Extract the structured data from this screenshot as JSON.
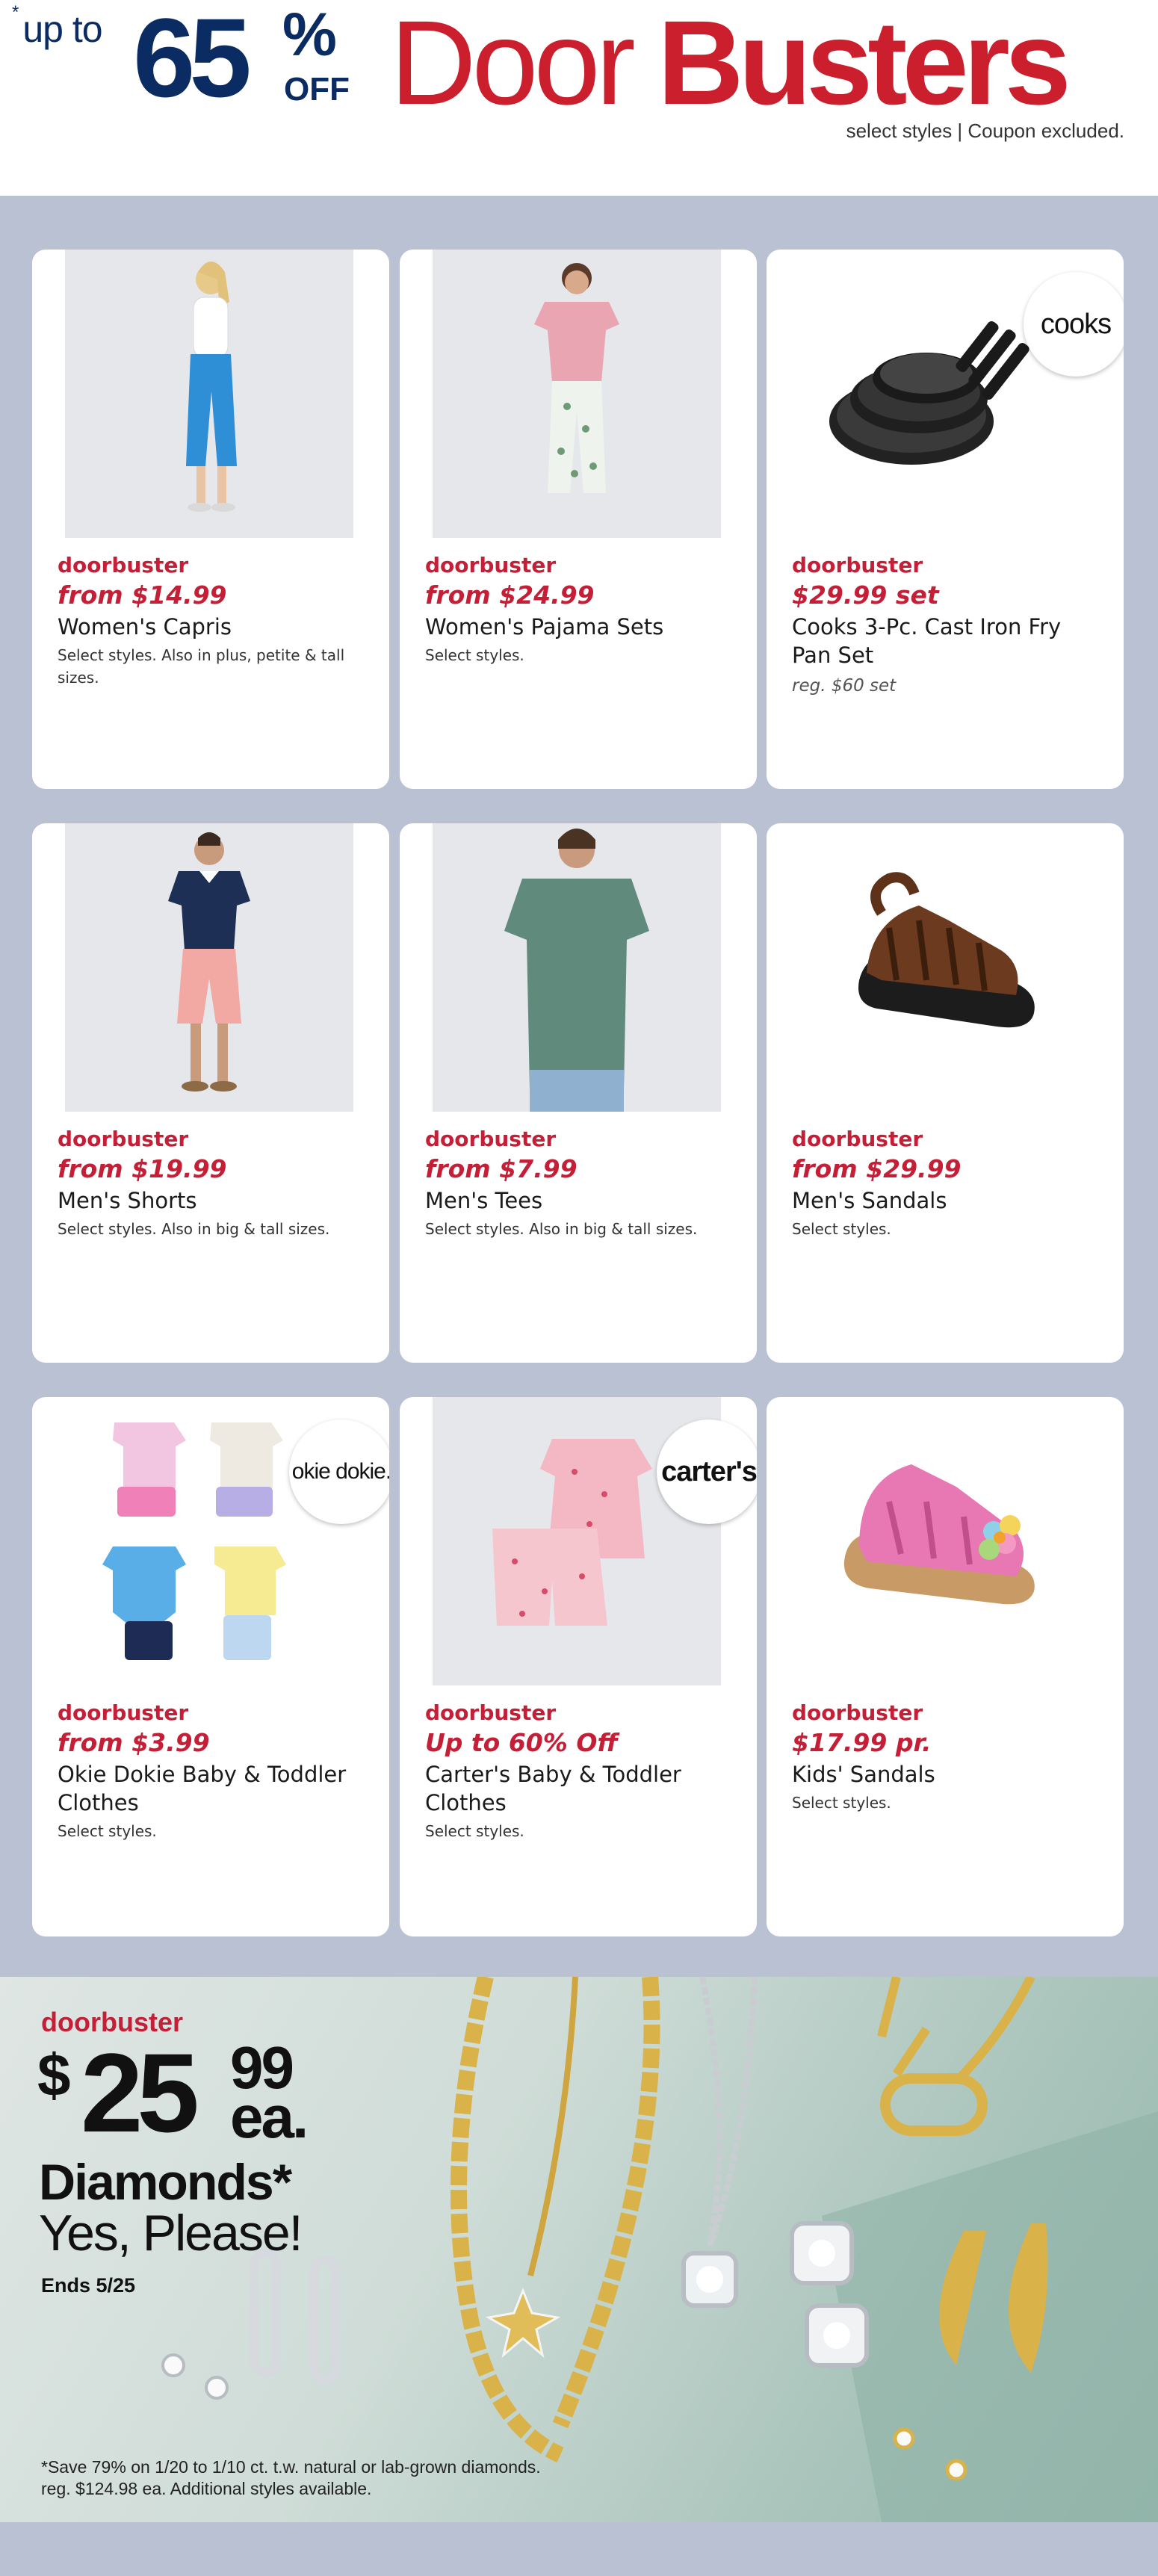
{
  "header": {
    "up_to_asterisk": "*",
    "up_to": "up to",
    "percent_number": "65",
    "percent_sign": "%",
    "off": "OFF",
    "title_door": "Door",
    "title_busters": "Busters",
    "note": "select styles | Coupon excluded."
  },
  "products": [
    {
      "tag": "doorbuster",
      "price": "from $14.99",
      "name": "Women's Capris",
      "detail": "Select styles. Also in plus, petite & tall sizes.",
      "reg": "",
      "badge": "",
      "image": "womens-capris-photo"
    },
    {
      "tag": "doorbuster",
      "price": "from $24.99",
      "name": "Women's Pajama Sets",
      "detail": "Select styles.",
      "reg": "",
      "badge": "",
      "image": "womens-pajama-photo"
    },
    {
      "tag": "doorbuster",
      "price": "$29.99 set",
      "name": "Cooks 3-Pc. Cast Iron Fry Pan Set",
      "detail": "",
      "reg": "reg. $60 set",
      "badge": "cooks",
      "image": "cast-iron-pans-photo"
    },
    {
      "tag": "doorbuster",
      "price": "from $19.99",
      "name": "Men's Shorts",
      "detail": "Select styles. Also in big & tall sizes.",
      "reg": "",
      "badge": "",
      "image": "mens-shorts-photo"
    },
    {
      "tag": "doorbuster",
      "price": "from $7.99",
      "name": "Men's Tees",
      "detail": "Select styles. Also in big & tall sizes.",
      "reg": "",
      "badge": "",
      "image": "mens-tees-photo"
    },
    {
      "tag": "doorbuster",
      "price": "from $29.99",
      "name": "Men's Sandals",
      "detail": "Select styles.",
      "reg": "",
      "badge": "",
      "image": "mens-sandals-photo"
    },
    {
      "tag": "doorbuster",
      "price": "from $3.99",
      "name": "Okie Dokie Baby & Toddler Clothes",
      "detail": "Select styles.",
      "reg": "",
      "badge": "okie dokie.",
      "image": "okie-dokie-clothes-photo"
    },
    {
      "tag": "doorbuster",
      "price": "Up to 60% Off",
      "name": "Carter's Baby & Toddler Clothes",
      "detail": "Select styles.",
      "reg": "",
      "badge": "carter's",
      "image": "carters-clothes-photo"
    },
    {
      "tag": "doorbuster",
      "price": "$17.99 pr.",
      "name": "Kids' Sandals",
      "detail": "Select styles.",
      "reg": "",
      "badge": "",
      "image": "kids-sandals-photo"
    }
  ],
  "jewelry": {
    "tag": "doorbuster",
    "dollar": "$",
    "price": "25",
    "cents": "99",
    "ea": "ea.",
    "headline": "Diamonds*",
    "subhead": "Yes, Please!",
    "ends": "Ends 5/25",
    "fine_print_1": "*Save 79% on 1/20 to 1/10 ct. t.w. natural or lab-grown diamonds.",
    "fine_print_2": "reg. $124.98 ea. Additional styles available."
  },
  "colors": {
    "brand_red": "#cc1f2d",
    "brand_navy": "#0b2c63",
    "page_background": "#b9c1d2",
    "card_background": "#ffffff"
  }
}
